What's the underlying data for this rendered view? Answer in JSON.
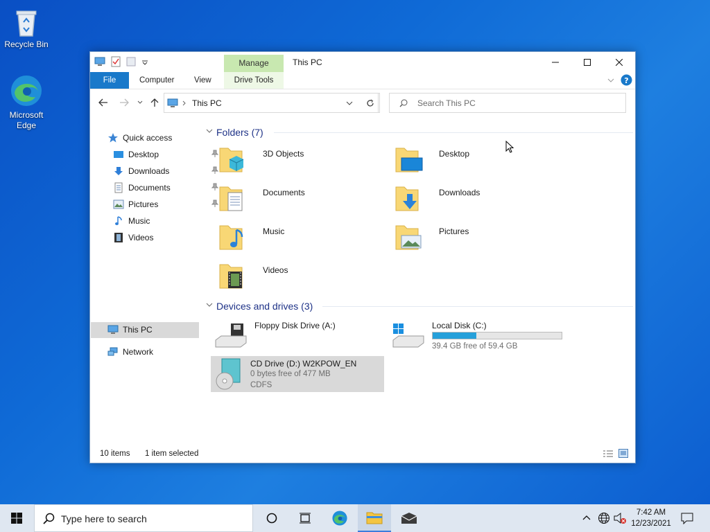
{
  "desktop": {
    "icons": [
      {
        "name": "recycle-bin",
        "label": "Recycle Bin"
      },
      {
        "name": "microsoft-edge",
        "label": "Microsoft Edge"
      }
    ]
  },
  "window": {
    "title": "This PC",
    "context_tab": "Manage",
    "ribbon_tabs": [
      "File",
      "Computer",
      "View",
      "Drive Tools"
    ],
    "address": "This PC",
    "search_placeholder": "Search This PC",
    "nav": {
      "quick_access": "Quick access",
      "items": [
        "Desktop",
        "Downloads",
        "Documents",
        "Pictures",
        "Music",
        "Videos"
      ],
      "this_pc": "This PC",
      "network": "Network"
    },
    "folders_group": "Folders (7)",
    "folders": [
      "3D Objects",
      "Desktop",
      "Documents",
      "Downloads",
      "Music",
      "Pictures",
      "Videos"
    ],
    "devices_group": "Devices and drives (3)",
    "drives": {
      "floppy": {
        "label": "Floppy Disk Drive (A:)"
      },
      "local": {
        "label": "Local Disk (C:)",
        "free": "39.4 GB free of 59.4 GB",
        "used_fraction": 0.337
      },
      "cd": {
        "label": "CD Drive (D:) W2KPOW_EN",
        "free": "0 bytes free of 477 MB",
        "fs": "CDFS"
      }
    },
    "status": {
      "items": "10 items",
      "selected": "1 item selected"
    }
  },
  "taskbar": {
    "search_placeholder": "Type here to search",
    "time": "7:42 AM",
    "date": "12/23/2021"
  },
  "colors": {
    "accent": "#1979ca",
    "selection": "#d9d9d9",
    "group_header": "#1e3287",
    "usage_bar": "#26a0da"
  }
}
